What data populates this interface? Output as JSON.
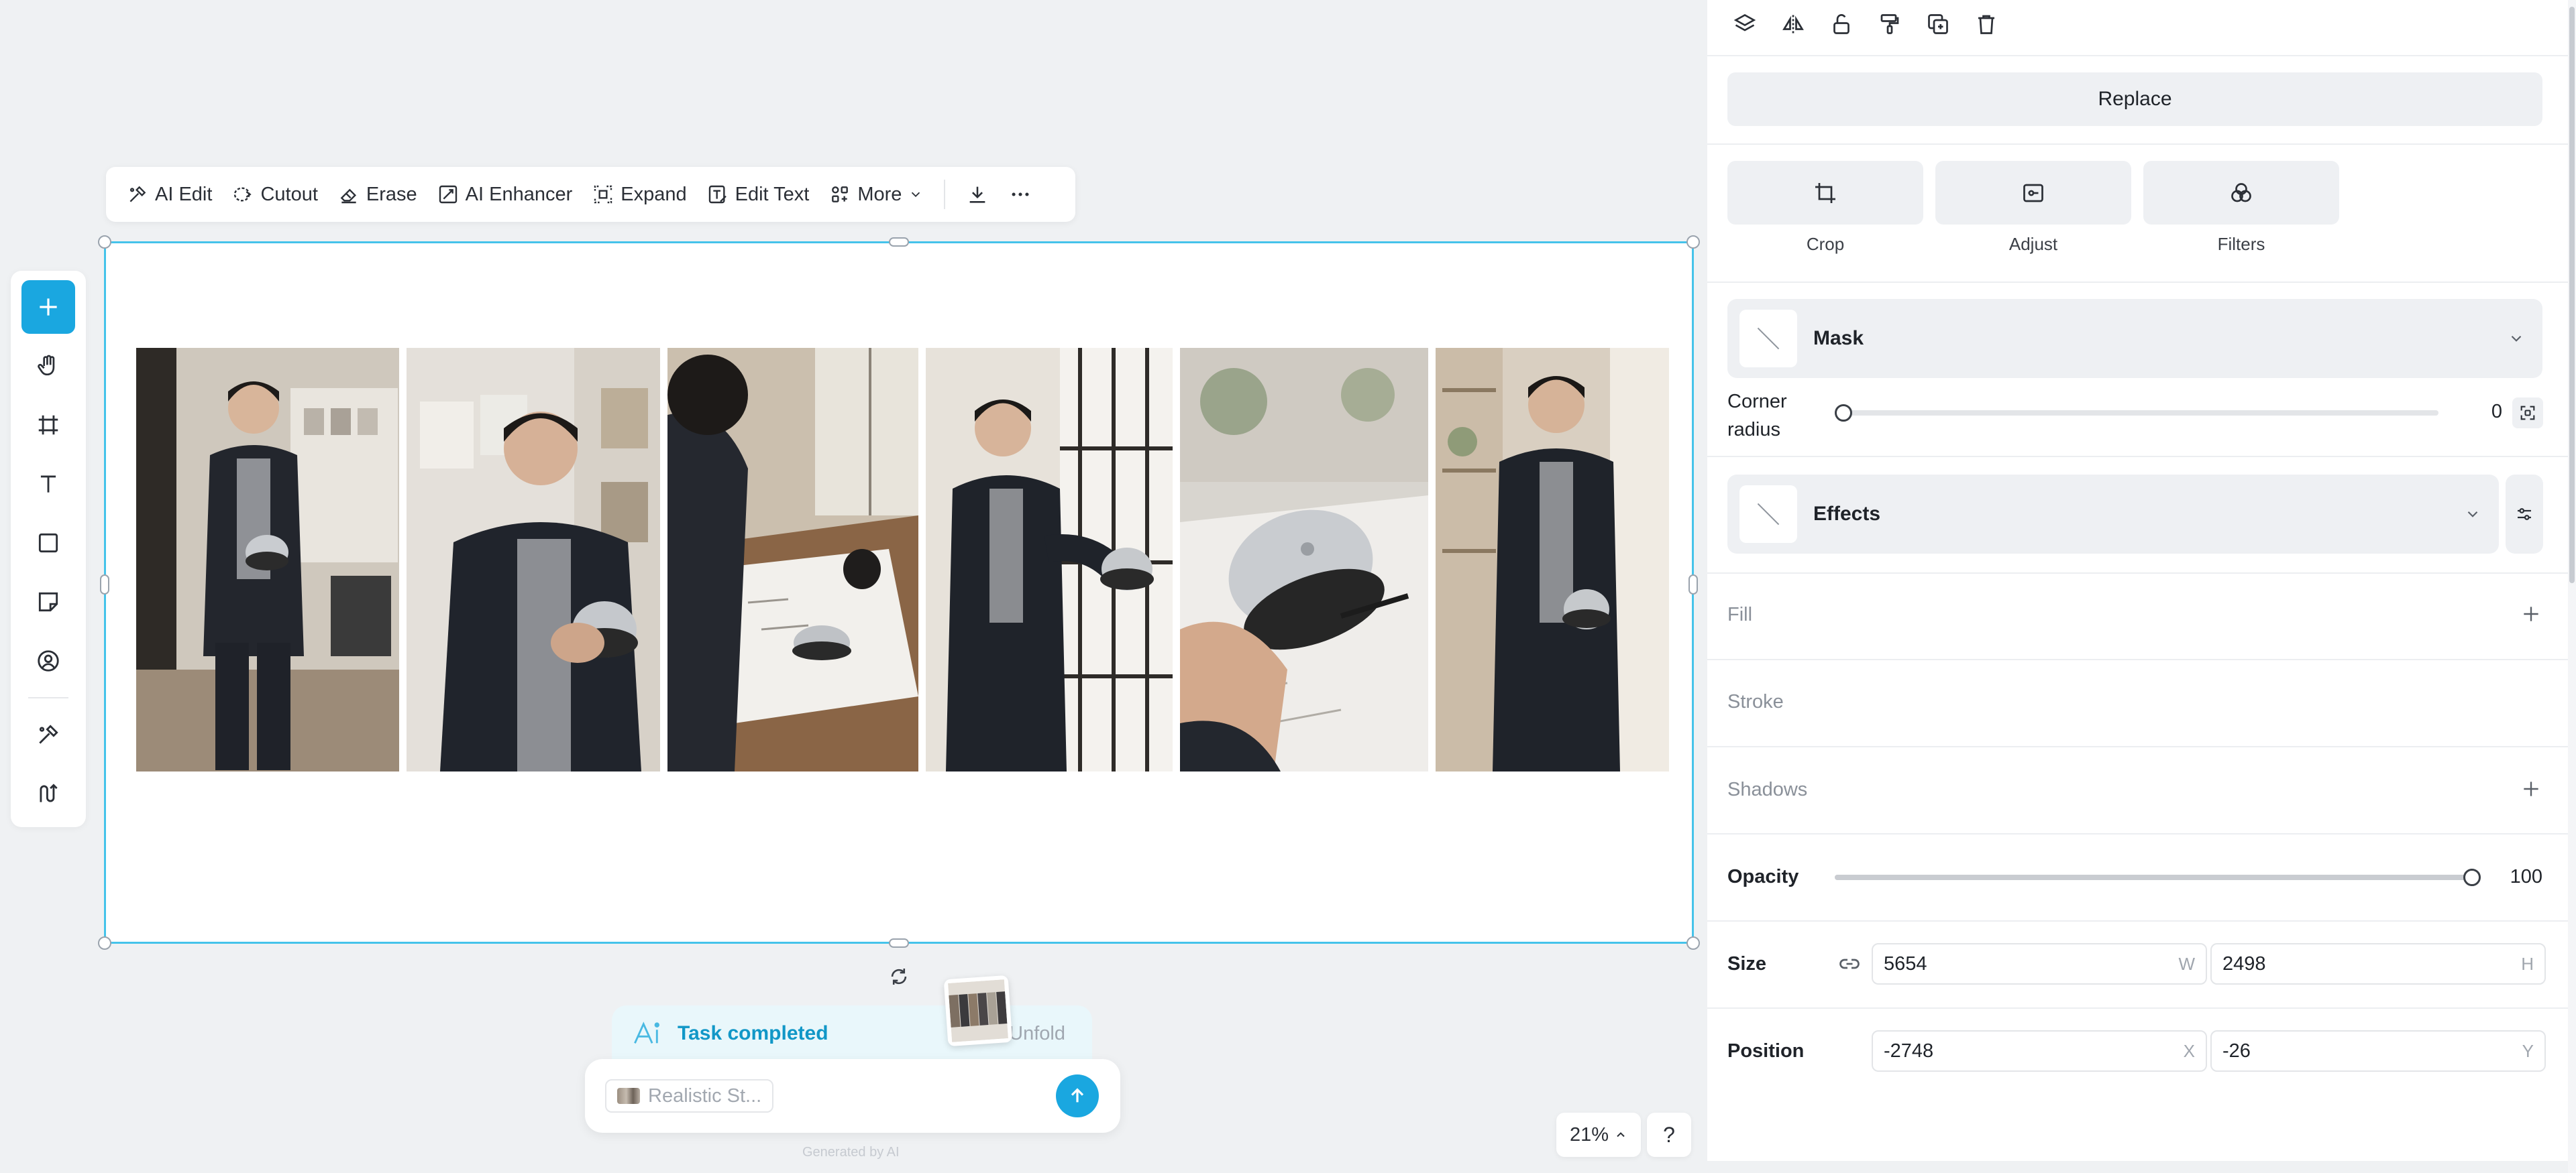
{
  "toolbar": {
    "ai_edit": "AI Edit",
    "cutout": "Cutout",
    "erase": "Erase",
    "ai_enhancer": "AI Enhancer",
    "expand": "Expand",
    "edit_text": "Edit Text",
    "more": "More"
  },
  "task": {
    "status": "Task completed",
    "unfold": "Unfold"
  },
  "prompt": {
    "chip_text": "Realistic St...",
    "generated_note": "Generated by AI"
  },
  "zoom": {
    "level": "21%"
  },
  "help": {
    "label": "?"
  },
  "panel": {
    "replace": "Replace",
    "crop": "Crop",
    "adjust": "Adjust",
    "filters": "Filters",
    "mask": "Mask",
    "corner_radius_label_1": "Corner",
    "corner_radius_label_2": "radius",
    "corner_radius_value": "0",
    "effects": "Effects",
    "fill": "Fill",
    "stroke": "Stroke",
    "shadows": "Shadows",
    "opacity_label": "Opacity",
    "opacity_value": "100",
    "size_label": "Size",
    "width": "5654",
    "width_unit": "W",
    "height": "2498",
    "height_unit": "H",
    "position_label": "Position",
    "x": "-2748",
    "x_unit": "X",
    "y": "-26",
    "y_unit": "Y"
  },
  "colors": {
    "accent": "#1aa7e0",
    "selection": "#45c3ea",
    "task_text": "#1197c7"
  },
  "icons": {
    "rail": [
      "plus-icon",
      "hand-icon",
      "frame-icon",
      "text-icon",
      "rectangle-icon",
      "sticky-note-icon",
      "avatar-icon",
      "ai-brush-icon",
      "ai-layout-icon"
    ],
    "panel_toolbar": [
      "layers-icon",
      "flip-icon",
      "unlock-icon",
      "paint-format-icon",
      "duplicate-icon",
      "trash-icon"
    ]
  }
}
